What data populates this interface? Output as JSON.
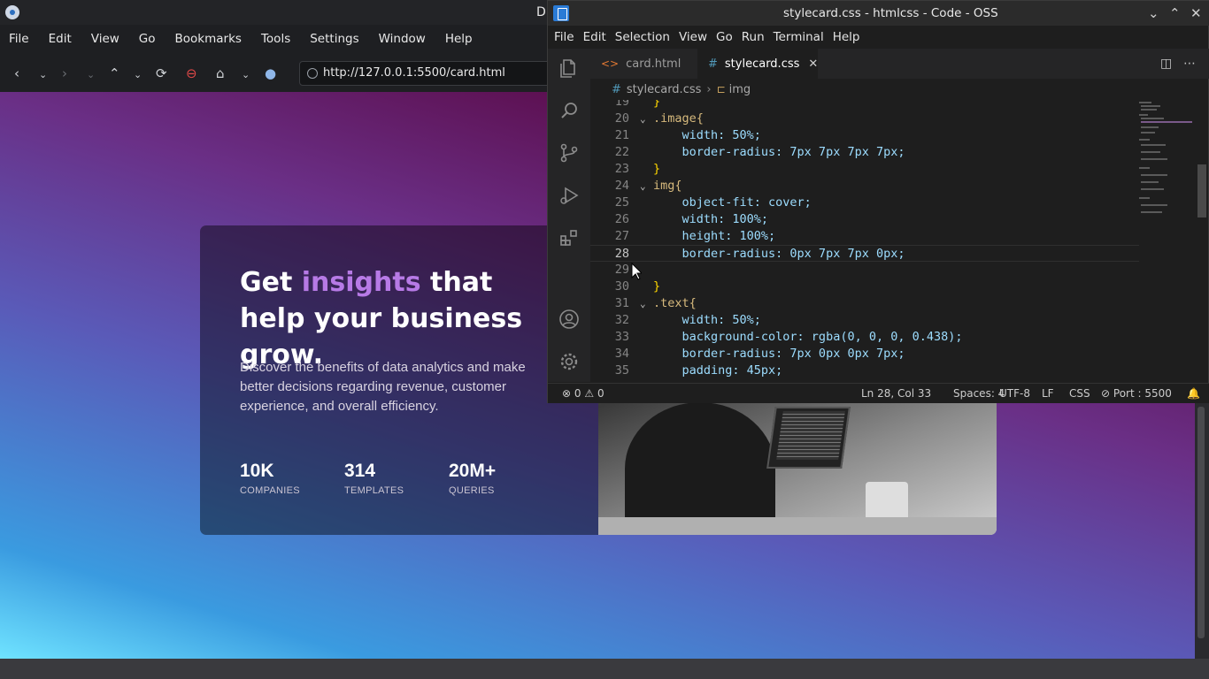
{
  "browser": {
    "title_fragment": "D",
    "menu": [
      "File",
      "Edit",
      "View",
      "Go",
      "Bookmarks",
      "Tools",
      "Settings",
      "Window",
      "Help"
    ],
    "url": "http://127.0.0.1:5500/card.html"
  },
  "page": {
    "headline_part1": "Get ",
    "headline_accent": "insights",
    "headline_part2": " that help your business grow.",
    "description": "Discover the benefits of data analytics and make better decisions regarding revenue, customer experience, and overall efficiency.",
    "stats": [
      {
        "number": "10K",
        "label": "COMPANIES"
      },
      {
        "number": "314",
        "label": "TEMPLATES"
      },
      {
        "number": "20M+",
        "label": "QUERIES"
      }
    ],
    "colors": {
      "accent": "#b77ae6",
      "card_overlay": "rgba(0, 0, 0, 0.438)"
    }
  },
  "editor": {
    "title": "stylecard.css - htmlcss - Code - OSS",
    "menu": [
      "File",
      "Edit",
      "Selection",
      "View",
      "Go",
      "Run",
      "Terminal",
      "Help"
    ],
    "tabs": [
      {
        "label": "card.html",
        "active": false
      },
      {
        "label": "stylecard.css",
        "active": true
      }
    ],
    "breadcrumb": {
      "file": "stylecard.css",
      "symbol": "img"
    },
    "code_lines": [
      {
        "n": "19",
        "text": "}"
      },
      {
        "n": "20",
        "text": ".image{"
      },
      {
        "n": "21",
        "text": "    width: 50%;"
      },
      {
        "n": "22",
        "text": "    border-radius: 7px 7px 7px 7px;"
      },
      {
        "n": "23",
        "text": "}"
      },
      {
        "n": "24",
        "text": "img{"
      },
      {
        "n": "25",
        "text": "    object-fit: cover;"
      },
      {
        "n": "26",
        "text": "    width: 100%;"
      },
      {
        "n": "27",
        "text": "    height: 100%;"
      },
      {
        "n": "28",
        "text": "    border-radius: 0px 7px 7px 0px;"
      },
      {
        "n": "29",
        "text": ""
      },
      {
        "n": "30",
        "text": "}"
      },
      {
        "n": "31",
        "text": ".text{"
      },
      {
        "n": "32",
        "text": "    width: 50%;"
      },
      {
        "n": "33",
        "text": "    background-color: rgba(0, 0, 0, 0.438);"
      },
      {
        "n": "34",
        "text": "    border-radius: 7px 0px 0px 7px;"
      },
      {
        "n": "35",
        "text": "    padding: 45px;"
      }
    ],
    "status": {
      "errors": "0",
      "warnings": "0",
      "position": "Ln 28, Col 33",
      "spaces": "Spaces: 4",
      "encoding": "UTF-8",
      "eol": "LF",
      "language": "CSS",
      "port": "Port : 5500"
    }
  }
}
